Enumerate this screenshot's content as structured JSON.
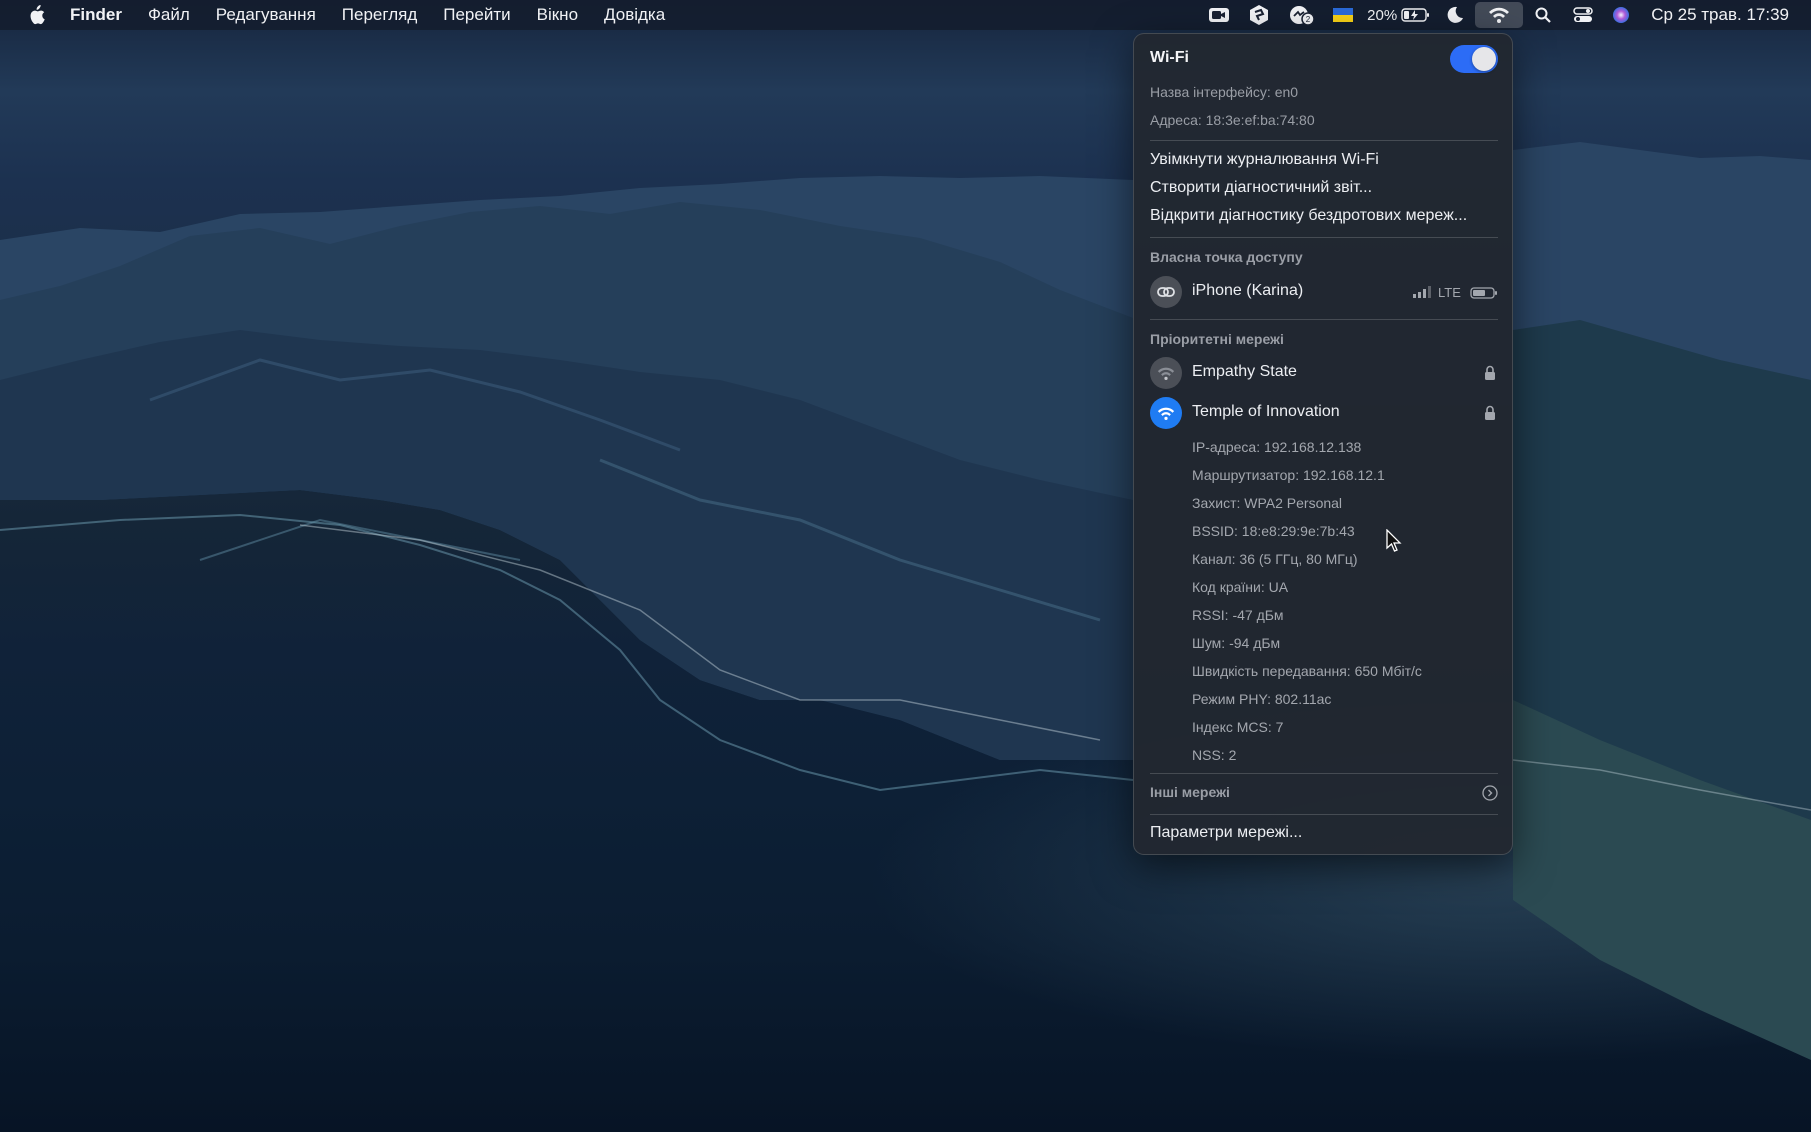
{
  "menubar": {
    "app_name": "Finder",
    "menus": [
      "Файл",
      "Редагування",
      "Перегляд",
      "Перейти",
      "Вікно",
      "Довідка"
    ],
    "battery_percent": "20%",
    "clock": "Ср 25 трав.  17:39"
  },
  "wifi_panel": {
    "title": "Wi-Fi",
    "toggle_on": true,
    "interface": "Назва інтерфейсу: en0",
    "address": "Адреса: 18:3e:ef:ba:74:80",
    "actions": [
      "Увімкнути журналювання Wi-Fi",
      "Створити діагностичний звіт...",
      "Відкрити діагностику бездротових мереж..."
    ],
    "hotspot_section": "Власна точка доступу",
    "hotspot": {
      "name": "iPhone (Karina)",
      "signal": "LTE"
    },
    "preferred_section": "Пріоритетні мережі",
    "networks": [
      {
        "name": "Empathy State",
        "locked": true,
        "connected": false
      },
      {
        "name": "Temple of Innovation",
        "locked": true,
        "connected": true
      }
    ],
    "details": [
      "IP-адреса: 192.168.12.138",
      "Маршрутизатор: 192.168.12.1",
      "Захист: WPA2 Personal",
      "BSSID: 18:e8:29:9e:7b:43",
      "Канал: 36 (5 ГГц, 80 МГц)",
      "Код країни: UA",
      "RSSI: -47 дБм",
      "Шум: -94 дБм",
      "Швидкість передавання: 650 Мбіт/с",
      "Режим PHY: 802.11ac",
      "Індекс MCS: 7",
      "NSS: 2"
    ],
    "other_networks": "Інші мережі",
    "settings": "Параметри мережі..."
  },
  "colors": {
    "accent": "#1f7cf3",
    "toggle": "#2c6cf6"
  }
}
